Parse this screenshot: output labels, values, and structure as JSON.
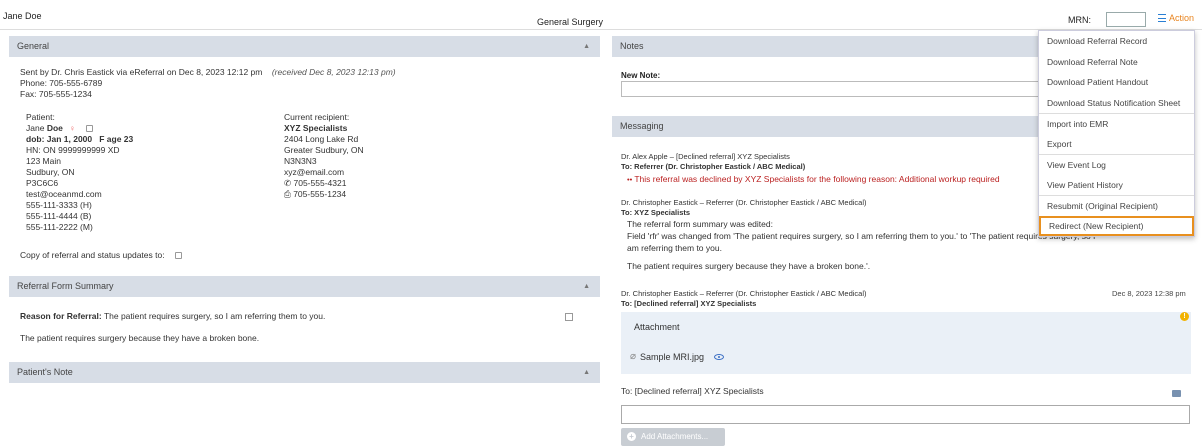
{
  "header": {
    "patient_name": "Jane Doe",
    "specialty": "General Surgery",
    "mrn_label": "MRN:",
    "mrn_value": "",
    "action_label": "Action"
  },
  "general": {
    "title": "General",
    "sent_by": "Sent by Dr. Chris Eastick via eReferral on Dec 8, 2023 12:12 pm",
    "received": "(received Dec 8, 2023 12:13 pm)",
    "phone": "Phone: 705-555-6789",
    "fax": "Fax: 705-555-1234",
    "patient": {
      "label": "Patient:",
      "first": "Jane",
      "last": "Doe",
      "dob": "dob: Jan 1, 2000",
      "sex_age": "F age 23",
      "hn": "HN: ON 9999999999 XD",
      "address1": "123 Main",
      "city": "Sudbury, ON",
      "postal": "P3C6C6",
      "email": "test@oceanmd.com",
      "phone_h": "555-111-3333 (H)",
      "phone_b": "555-111-4444 (B)",
      "phone_m": "555-111-2222 (M)"
    },
    "recipient": {
      "label": "Current recipient:",
      "name": "XYZ Specialists",
      "address1": "2404 Long Lake Rd",
      "city": "Greater Sudbury, ON",
      "postal": "N3N3N3",
      "email": "xyz@email.com",
      "phone": "705-555-4321",
      "fax": "705-555-1234"
    },
    "copy_label": "Copy of referral and status updates to:"
  },
  "referral_form": {
    "title": "Referral Form Summary",
    "reason_label": "Reason for Referral:",
    "reason_text": "The patient requires surgery, so I am referring them to you.",
    "extra_text": "The patient requires surgery because they have a broken bone."
  },
  "patients_note": {
    "title": "Patient's Note"
  },
  "notes": {
    "title": "Notes",
    "new_note_label": "New Note:"
  },
  "messaging": {
    "title": "Messaging",
    "messages": [
      {
        "from": "Dr. Alex Apple – [Declined referral] XYZ Specialists",
        "to": "To: Referrer (Dr. Christopher Eastick / ABC Medical)",
        "text": "This referral was declined by XYZ Specialists for the following reason: Additional workup required"
      },
      {
        "from": "Dr. Christopher Eastick – Referrer (Dr. Christopher Eastick / ABC Medical)",
        "to": "To: XYZ Specialists",
        "line1": "The referral form summary was edited:",
        "line2": "Field 'rfr' was changed from 'The patient requires surgery, so I am referring them to you.' to 'The patient requires surgery, so I",
        "line3": "am referring them to you.",
        "line4": "The patient requires surgery because they have a broken bone.'."
      },
      {
        "from": "Dr. Christopher Eastick – Referrer (Dr. Christopher Eastick / ABC Medical)",
        "to": "To: [Declined referral] XYZ Specialists",
        "date": "Dec 8, 2023 12:38 pm",
        "attachment_title": "Attachment",
        "file": "Sample MRI.jpg"
      }
    ],
    "reply_to": "To: [Declined referral] XYZ Specialists",
    "add_attachments": "Add Attachments..."
  },
  "action_menu": {
    "items": [
      "Download Referral Record",
      "Download Referral Note",
      "Download Patient Handout",
      "Download Status Notification Sheet",
      "Import into EMR",
      "Export",
      "View Event Log",
      "View Patient History",
      "Resubmit (Original Recipient)",
      "Redirect (New Recipient)"
    ]
  },
  "colors": {
    "accent": "#e8841f",
    "panel_header": "#d7dde6",
    "declined": "#bb2222",
    "link": "#2a7fd4"
  }
}
